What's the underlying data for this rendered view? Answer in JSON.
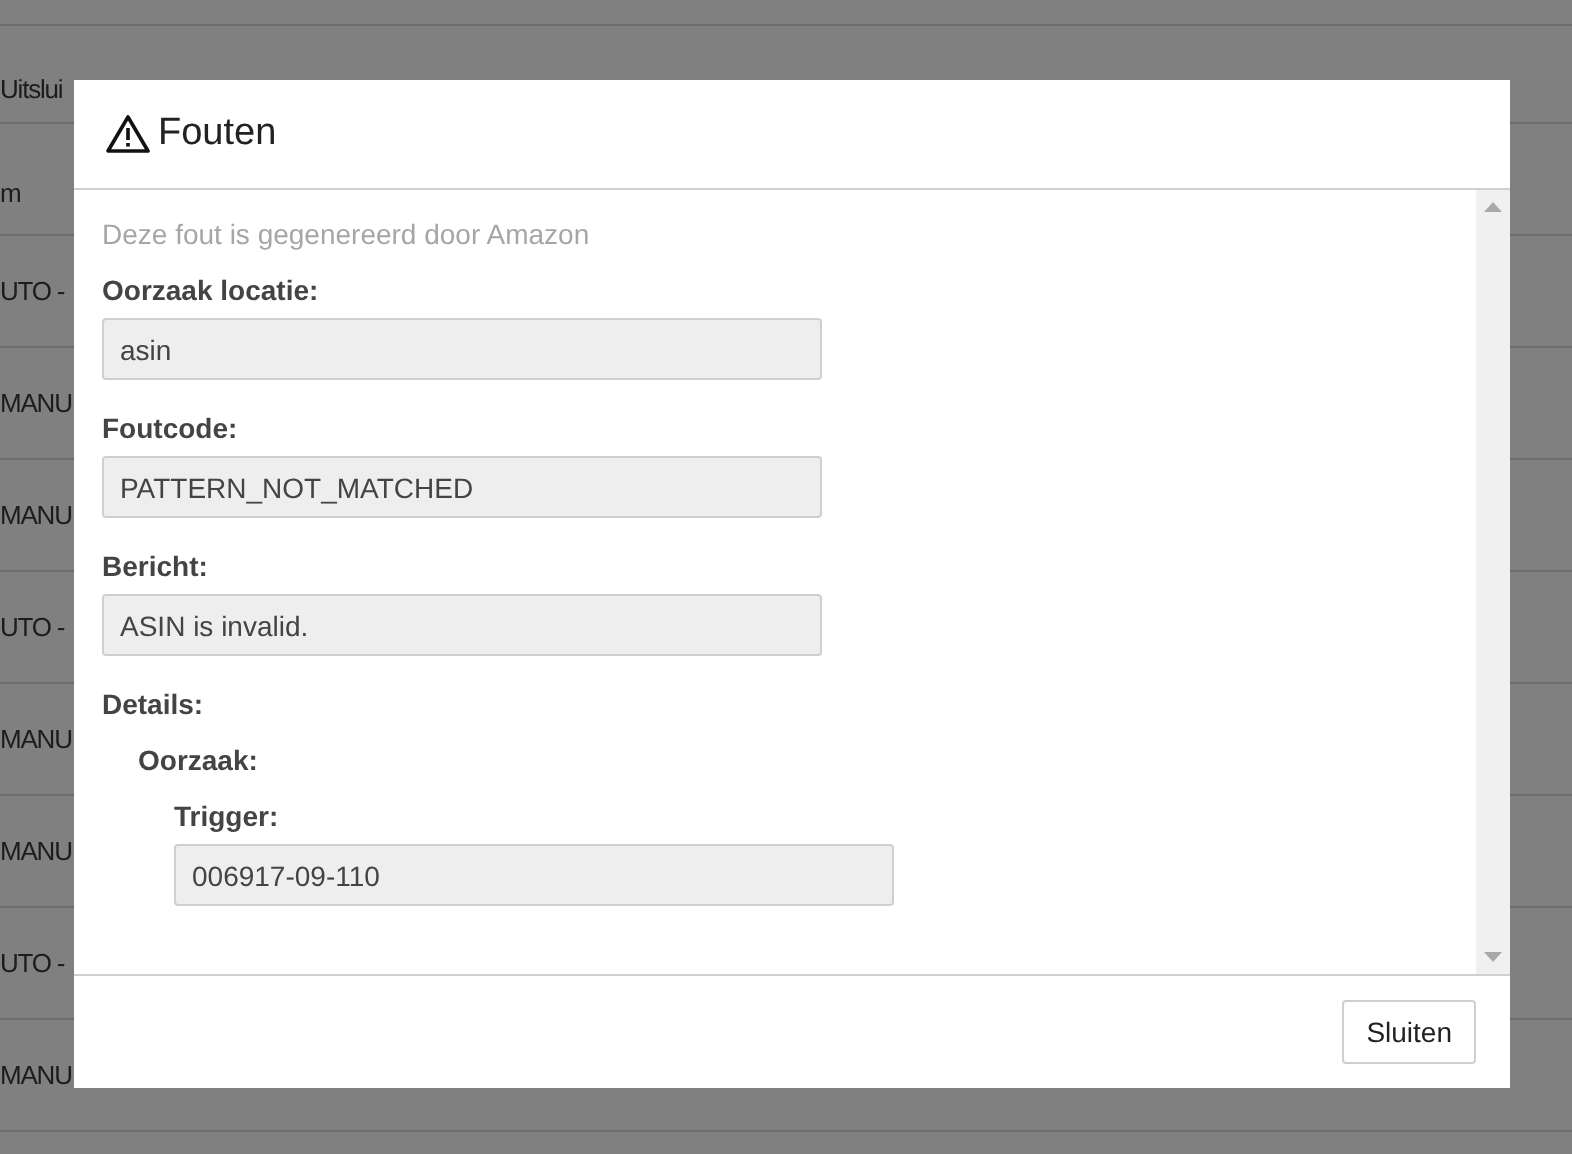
{
  "background": {
    "header": "Uitslui",
    "subheader": "m",
    "rows": [
      "UTO -",
      "MANU",
      "MANU",
      "UTO -",
      "MANU",
      "MANU",
      "UTO -",
      "MANU"
    ]
  },
  "dialog": {
    "title": "Fouten",
    "note": "Deze fout is gegenereerd door Amazon",
    "items": [
      {
        "label": "Oorzaak locatie:",
        "value": "asin"
      },
      {
        "label": "Foutcode:",
        "value": "PATTERN_NOT_MATCHED"
      },
      {
        "label": "Bericht:",
        "value": "ASIN is invalid."
      },
      {
        "label": "Details:",
        "children": [
          {
            "label": "Oorzaak:",
            "children": [
              {
                "label": "Trigger:",
                "value": "006917-09-110"
              }
            ]
          }
        ]
      }
    ],
    "buttons": [
      "Sluiten"
    ]
  }
}
